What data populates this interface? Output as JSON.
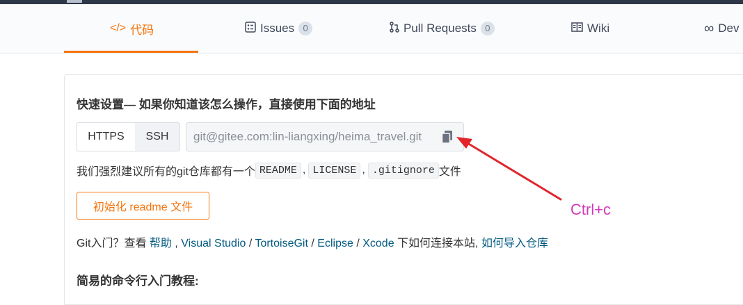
{
  "tabs": [
    {
      "label": "代码",
      "icon": "code-icon",
      "active": true
    },
    {
      "label": "Issues",
      "icon": "issues-icon",
      "badge": "0"
    },
    {
      "label": "Pull Requests",
      "icon": "pull-request-icon",
      "badge": "0"
    },
    {
      "label": "Wiki",
      "icon": "book-icon"
    },
    {
      "label": "Dev",
      "icon": "infinity-icon"
    }
  ],
  "quick_setup": {
    "heading": "快速设置— 如果你知道该怎么操作，直接使用下面的地址",
    "protocols": [
      "HTTPS",
      "SSH"
    ],
    "selected_protocol": "SSH",
    "url": "git@gitee.com:lin-liangxing/heima_travel.git",
    "recommend_prefix": "我们强烈建议所有的git仓库都有一个",
    "files": [
      "README",
      "LICENSE",
      ".gitignore"
    ],
    "separator": ",",
    "recommend_suffix": "文件",
    "init_button": "初始化 readme 文件"
  },
  "help": {
    "prefix": "Git入门？查看",
    "help_link": "帮助",
    "tools": [
      "Visual Studio",
      "TortoiseGit",
      "Eclipse",
      "Xcode"
    ],
    "middle": "下如何连接本站,",
    "import_link": "如何导入仓库"
  },
  "tutorial_heading": "简易的命令行入门教程:",
  "annotation": {
    "text": "Ctrl+c",
    "arrow_color": "#e0262b",
    "text_color": "#d03bb8"
  },
  "colors": {
    "accent": "#f5740c",
    "link": "#005980"
  }
}
